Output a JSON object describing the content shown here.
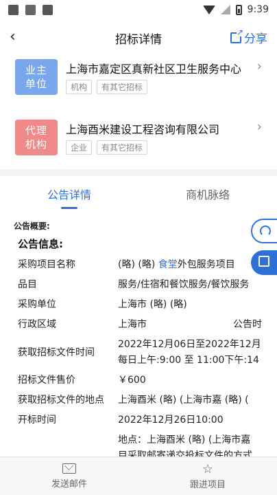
{
  "status_bar": {
    "time": "9:39"
  },
  "nav": {
    "title": "招标详情",
    "share_label": "分享"
  },
  "owner_card": {
    "badge": "业主\n单位",
    "badge_line1": "业主",
    "badge_line2": "单位",
    "name": "上海市嘉定区真新社区卫生服务中心",
    "tags": [
      "机构",
      "有其它招标"
    ]
  },
  "agent_card": {
    "badge_line1": "代理",
    "badge_line2": "机构",
    "name": "上海酉米建设工程咨询有限公司",
    "tags": [
      "企业",
      "有其它招标"
    ]
  },
  "tabs": [
    "公告详情",
    "商机脉络"
  ],
  "content": {
    "summary_label": "公告概要:",
    "info_label": "公告信息:",
    "rows": [
      {
        "label": "采购项目名称",
        "value_prefix": "(略) (略) ",
        "value_link": "食堂",
        "value_suffix": "外包服务项目"
      },
      {
        "label": "品目",
        "value": "服务/住宿和餐饮服务/餐饮服务"
      },
      {
        "label": "采购单位",
        "value": "上海市 (略) (略)"
      },
      {
        "label": "行政区域",
        "value": "上海市",
        "value2": "公告时"
      },
      {
        "label": "获取招标文件时间",
        "value": "2022年12月06日至2022年12月",
        "value_line2": "每日上午:9:00 至 11:00下午:14"
      },
      {
        "label": "招标文件售价",
        "value": "￥600"
      },
      {
        "label": "获取招标文件的地点",
        "value": "上海酉米 (略) (上海市嘉 (略) ("
      },
      {
        "label": "开标时间",
        "value": "2022年12月26日10:00"
      }
    ],
    "extra_line1": "地点：上海酉米 (略) (上海市嘉",
    "extra_line2": "目采取邮寄递交投标文件的方式"
  },
  "bottom_bar": {
    "send_mail": "发送邮件",
    "follow": "跟进项目"
  },
  "colors": {
    "accent": "#2f6fd8",
    "owner_badge": "#7aa7ec",
    "agent_badge": "#f08a8a"
  }
}
